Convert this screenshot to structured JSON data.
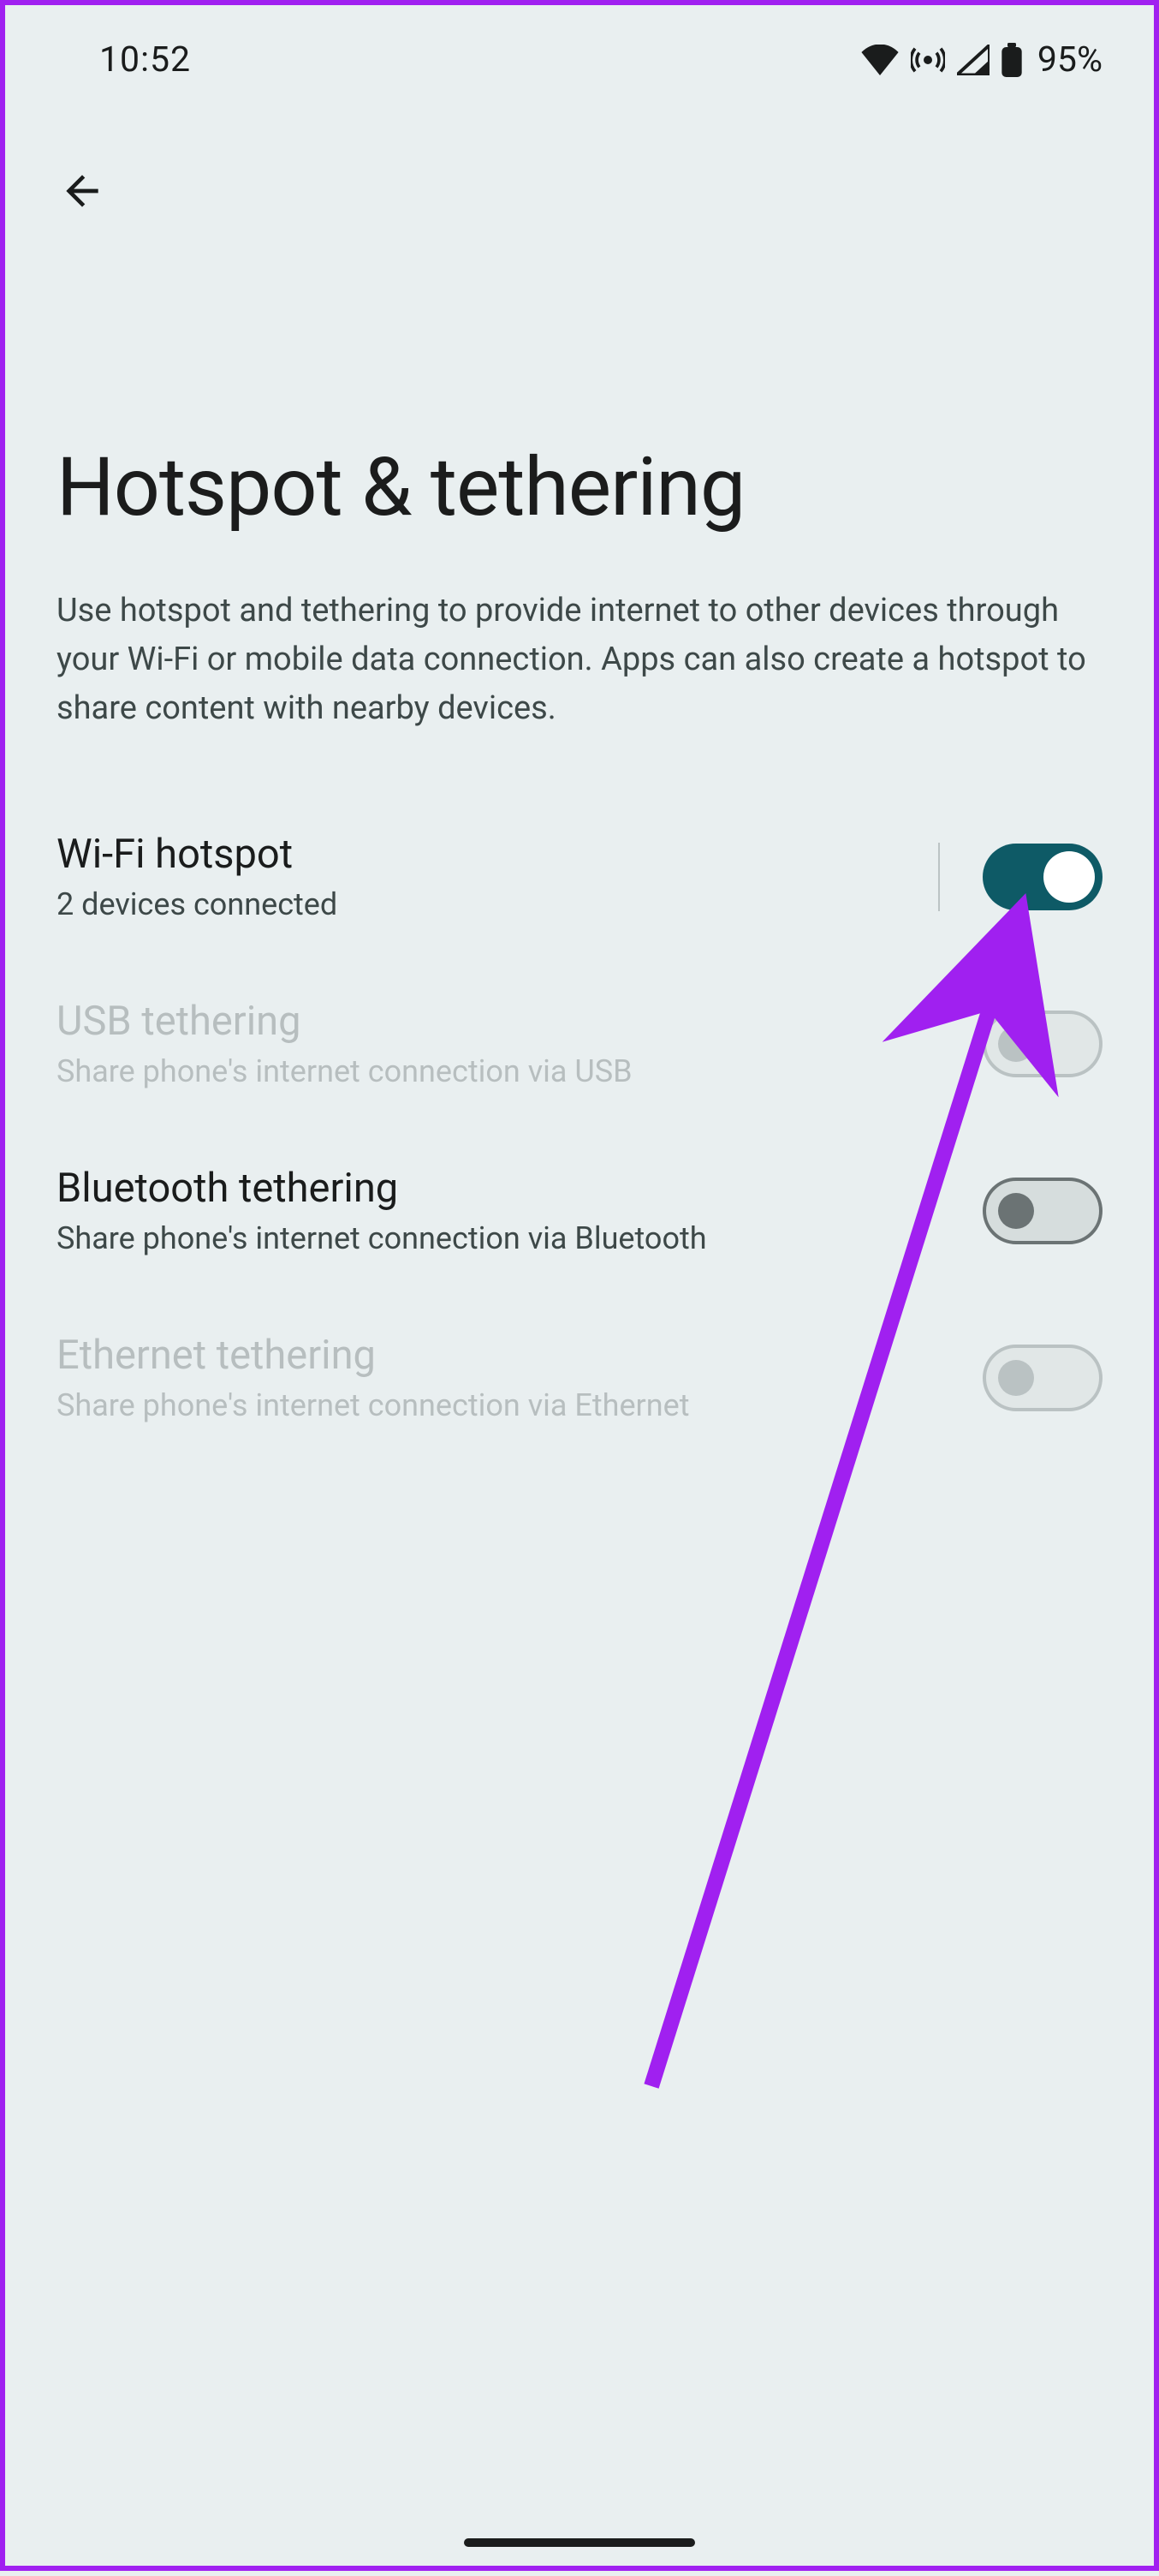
{
  "status": {
    "time": "10:52",
    "battery_text": "95%"
  },
  "page": {
    "title": "Hotspot & tethering",
    "description": "Use hotspot and tethering to provide internet to other devices through your Wi-Fi or mobile data connection. Apps can also create a hotspot to share content with nearby devices."
  },
  "settings": {
    "wifi_hotspot": {
      "title": "Wi-Fi hotspot",
      "subtitle": "2 devices connected",
      "on": true,
      "enabled": true
    },
    "usb": {
      "title": "USB tethering",
      "subtitle": "Share phone's internet connection via USB",
      "on": false,
      "enabled": false
    },
    "bluetooth": {
      "title": "Bluetooth tethering",
      "subtitle": "Share phone's internet connection via Bluetooth",
      "on": false,
      "enabled": true
    },
    "ethernet": {
      "title": "Ethernet tethering",
      "subtitle": "Share phone's internet connection via Ethernet",
      "on": false,
      "enabled": false
    }
  }
}
